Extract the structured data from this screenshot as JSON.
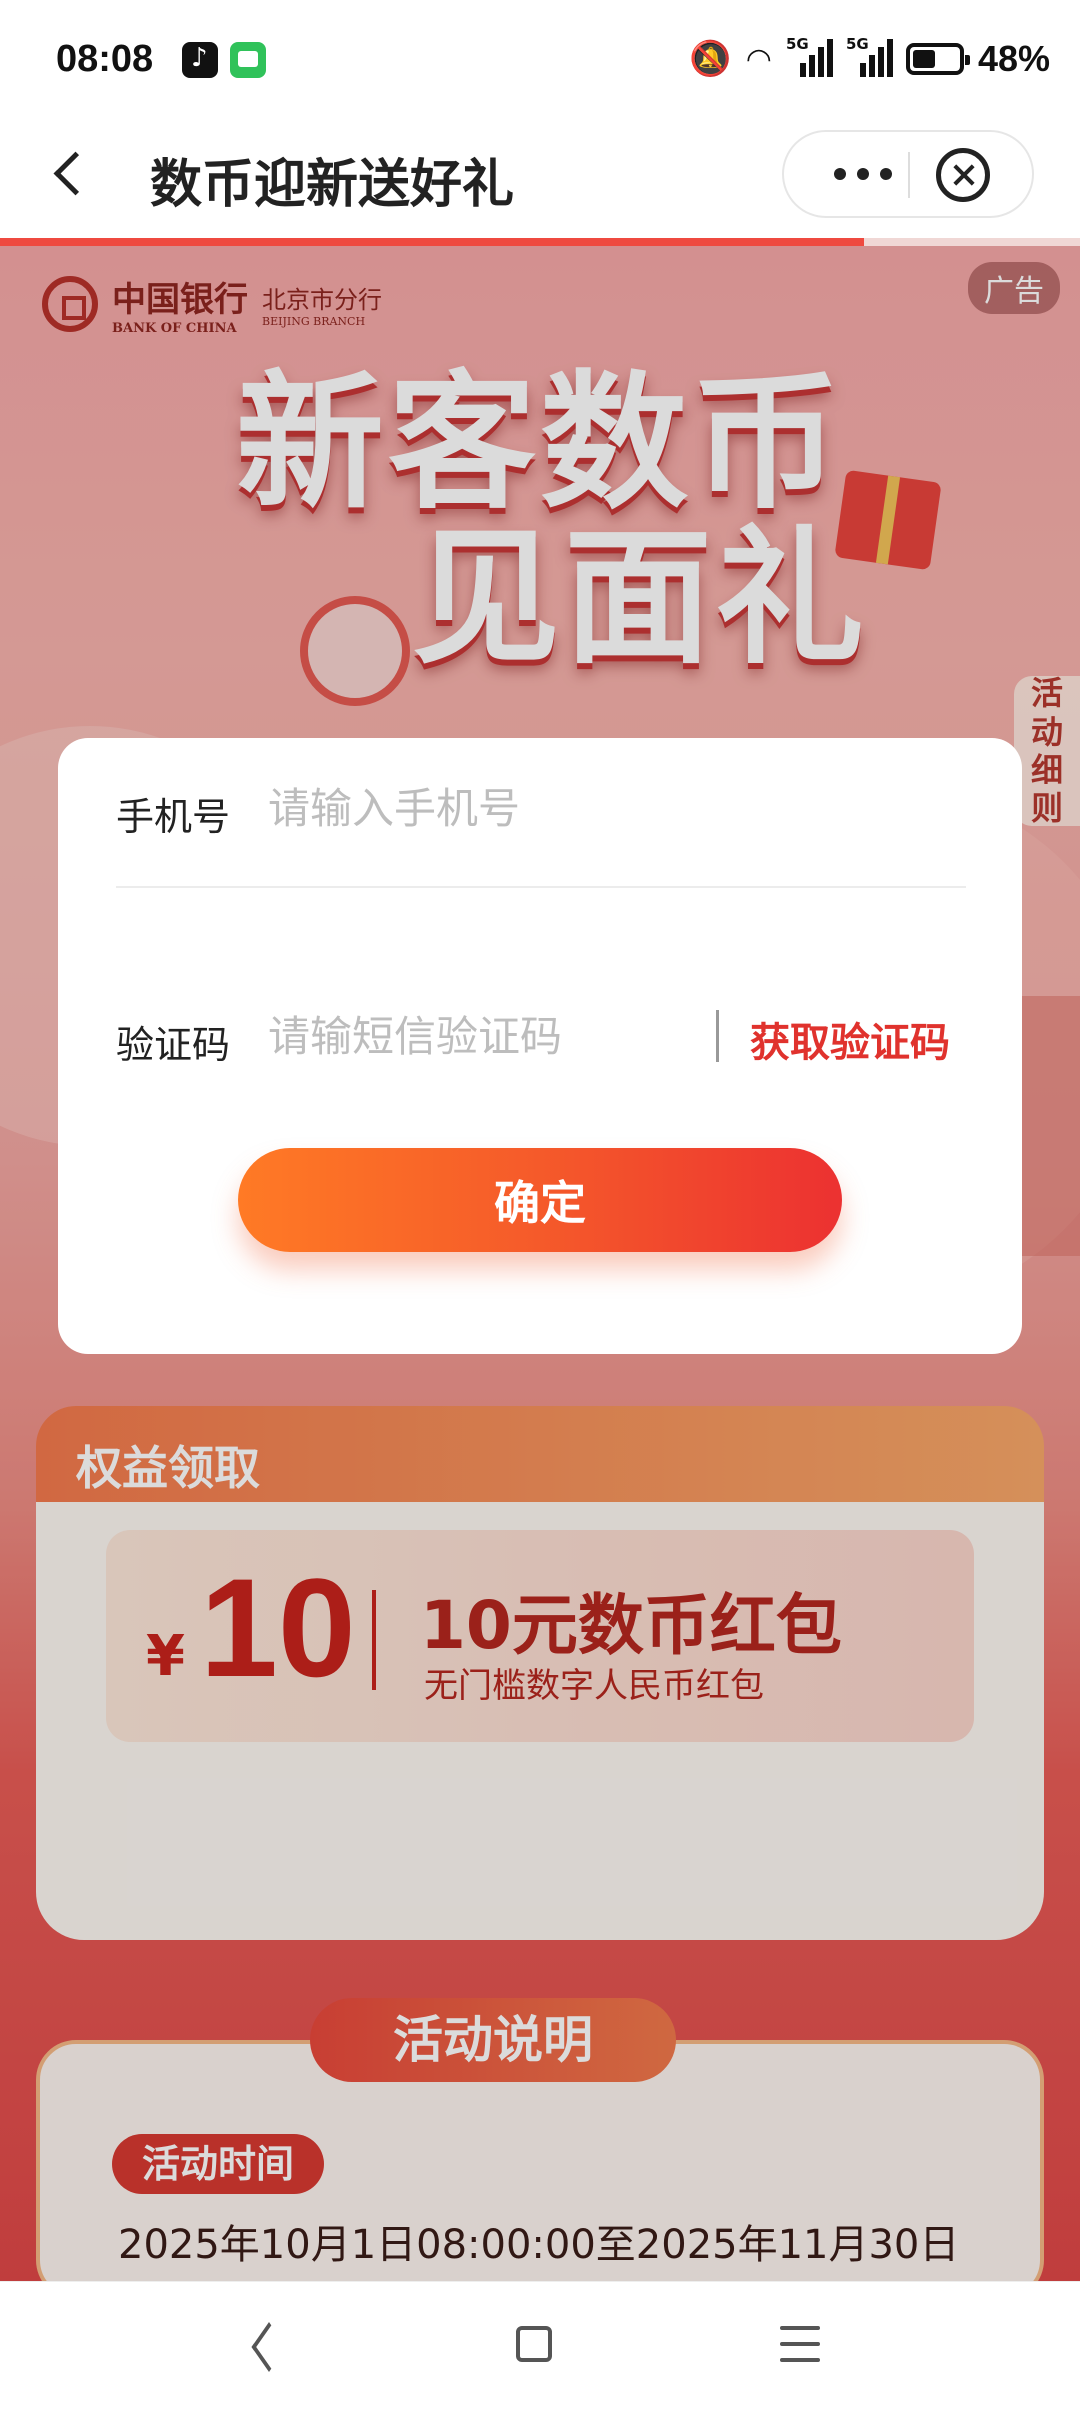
{
  "status_bar": {
    "time": "08:08",
    "apps": [
      "tiktok-icon",
      "messages-icon"
    ],
    "icons": [
      "mute-icon",
      "wifi-icon",
      "signal-5g-icon",
      "signal-5g-icon",
      "battery-icon"
    ],
    "network_1": "5G",
    "network_2": "5G",
    "battery_percent": "48%",
    "battery_level": 0.48
  },
  "nav": {
    "title": "数币迎新送好礼",
    "back_icon": "chevron-left-icon",
    "more_icon": "more-dots-icon",
    "close_icon": "close-circle-icon",
    "load_progress": 0.8
  },
  "banner": {
    "bank_name": "中国银行",
    "bank_name_en": "BANK OF CHINA",
    "branch": "北京市分行",
    "branch_en": "BEIJING BRANCH",
    "ad_label": "广告",
    "hero_line1": "新客数币",
    "hero_line2": "见面礼",
    "side_rules": [
      "活",
      "动",
      "细",
      "则"
    ]
  },
  "modal": {
    "phone_label": "手机号",
    "phone_placeholder": "请输入手机号",
    "phone_value": "",
    "code_label": "验证码",
    "code_placeholder": "请输短信验证码",
    "code_value": "",
    "get_code_label": "获取验证码",
    "confirm_label": "确定"
  },
  "rights": {
    "title": "权益领取",
    "coupon": {
      "currency": "¥",
      "amount": "10",
      "name": "10元数币红包",
      "desc": "无门槛数字人民币红包"
    }
  },
  "explain": {
    "title": "活动说明",
    "time_label": "活动时间",
    "time_text": "2025年10月1日08:00:00至2025年11月30日"
  },
  "system_nav": {
    "icons": [
      "back-triangle-icon",
      "home-square-icon",
      "menu-lines-icon"
    ]
  },
  "colors": {
    "accent": "#e0322d",
    "button_start": "#ff7a25",
    "button_end": "#ec3131"
  }
}
